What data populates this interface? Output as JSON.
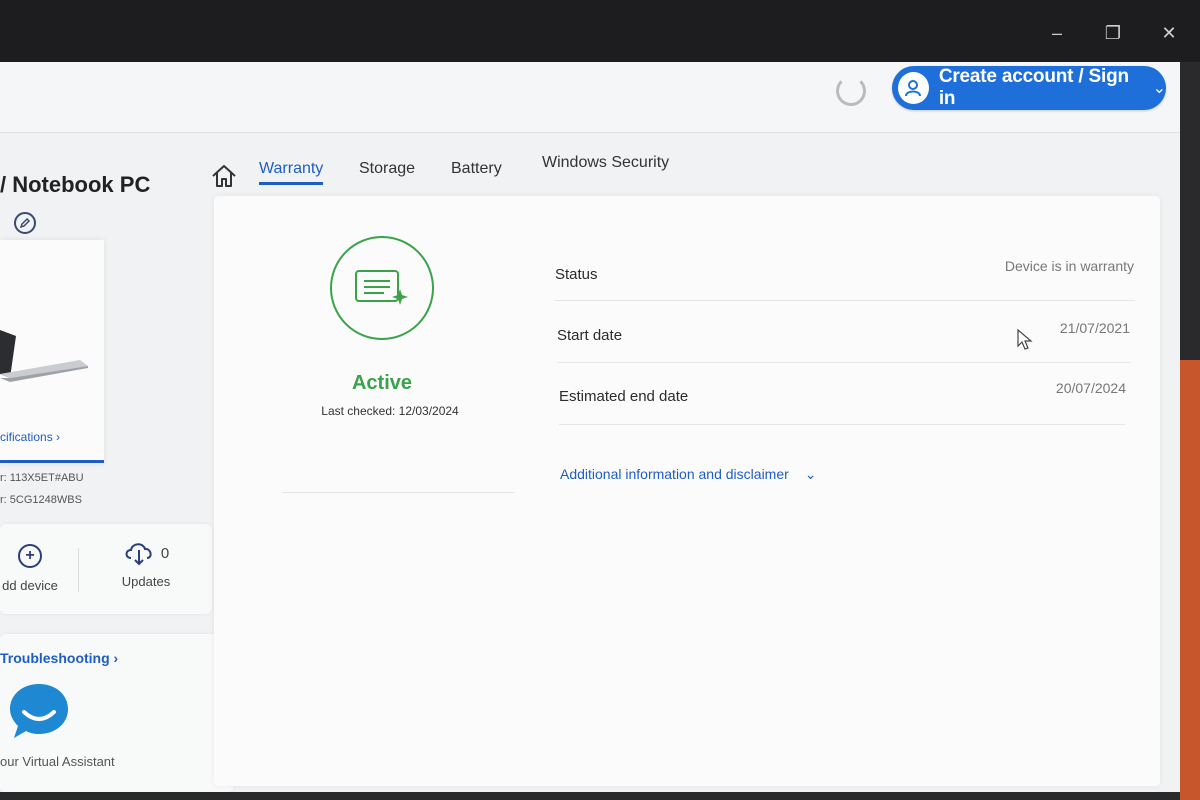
{
  "header": {
    "signin_label": "Create account / Sign in"
  },
  "device": {
    "title": "/ Notebook PC",
    "specs_link": "cifications ›",
    "product_line": "r: 113X5ET#ABU",
    "serial_line": "r: 5CG1248WBS"
  },
  "actions": {
    "add_device": "dd device",
    "updates_label": "Updates",
    "updates_count": "0"
  },
  "assistant": {
    "troubleshooting": "Troubleshooting ›",
    "label": "our Virtual Assistant"
  },
  "tabs": [
    {
      "label": "Warranty"
    },
    {
      "label": "Storage"
    },
    {
      "label": "Battery"
    },
    {
      "label": "Windows Security"
    }
  ],
  "warranty": {
    "state": "Active",
    "last_checked": "Last checked: 12/03/2024",
    "rows": [
      {
        "label": "Status",
        "value": "Device is in warranty"
      },
      {
        "label": "Start date",
        "value": "21/07/2021"
      },
      {
        "label": "Estimated end date",
        "value": "20/07/2024"
      }
    ],
    "more_info": "Additional information and disclaimer"
  },
  "colors": {
    "accent": "#1e5ec2",
    "active_green": "#3aa34a",
    "signin_bg": "#1e6fd9"
  }
}
